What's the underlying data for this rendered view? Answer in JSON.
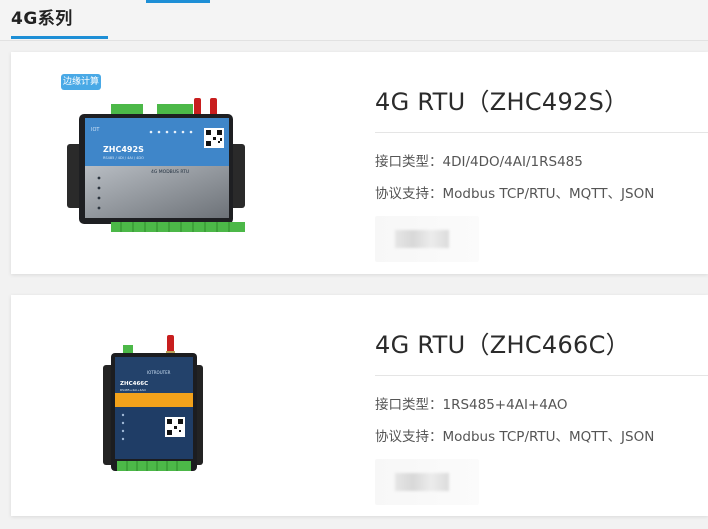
{
  "tabs": {
    "active_label": "4G系列"
  },
  "products": [
    {
      "title": "4G RTU（ZHC492S）",
      "interface": "接口类型：4DI/4DO/4AI/1RS485",
      "protocol": "协议支持：Modbus TCP/RTU、MQTT、JSON",
      "badge": "边缘计算",
      "device_model": "ZHC492S",
      "device_sub": "RS485 / 4DI / 4AI / 4DO",
      "device_caption": "4G MODBUS RTU",
      "device_brand": "IOT"
    },
    {
      "title": "4G RTU（ZHC466C）",
      "interface": "接口类型：1RS485+4AI+4AO",
      "protocol": "协议支持：Modbus TCP/RTU、MQTT、JSON",
      "device_model": "ZHC466C",
      "device_sub": "RS485+4AI+4AO",
      "device_brand": "IOTROUTER"
    }
  ],
  "colors": {
    "accent": "#1e8fd6",
    "badge": "#49a9e6",
    "device_blue": "#3f86c9",
    "device_orange": "#f3a21b"
  }
}
